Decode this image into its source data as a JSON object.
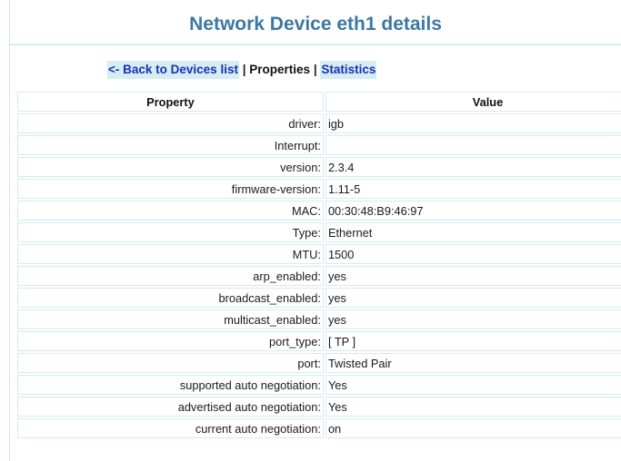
{
  "header": {
    "title": "Network Device eth1 details"
  },
  "nav": {
    "back_label": "<- Back to Devices list",
    "separator": "|",
    "properties_label": "Properties",
    "statistics_label": "Statistics"
  },
  "table": {
    "columns": [
      "Property",
      "Value"
    ],
    "rows": [
      {
        "name": "driver:",
        "value": "igb"
      },
      {
        "name": "Interrupt:",
        "value": ""
      },
      {
        "name": "version:",
        "value": "2.3.4"
      },
      {
        "name": "firmware-version:",
        "value": "1.11-5"
      },
      {
        "name": "MAC:",
        "value": "00:30:48:B9:46:97"
      },
      {
        "name": "Type:",
        "value": "Ethernet"
      },
      {
        "name": "MTU:",
        "value": "1500"
      },
      {
        "name": "arp_enabled:",
        "value": "yes"
      },
      {
        "name": "broadcast_enabled:",
        "value": "yes"
      },
      {
        "name": "multicast_enabled:",
        "value": "yes"
      },
      {
        "name": "port_type:",
        "value": "[ TP ]"
      },
      {
        "name": "port:",
        "value": "Twisted Pair"
      },
      {
        "name": "supported auto negotiation:",
        "value": "Yes"
      },
      {
        "name": "advertised auto negotiation:",
        "value": "Yes"
      },
      {
        "name": "current auto negotiation:",
        "value": "on"
      }
    ]
  },
  "colors": {
    "title": "#3d78a4",
    "link": "#1b2fb3",
    "link_background": "#d6edf4",
    "cell_border": "#d3ebf2"
  }
}
